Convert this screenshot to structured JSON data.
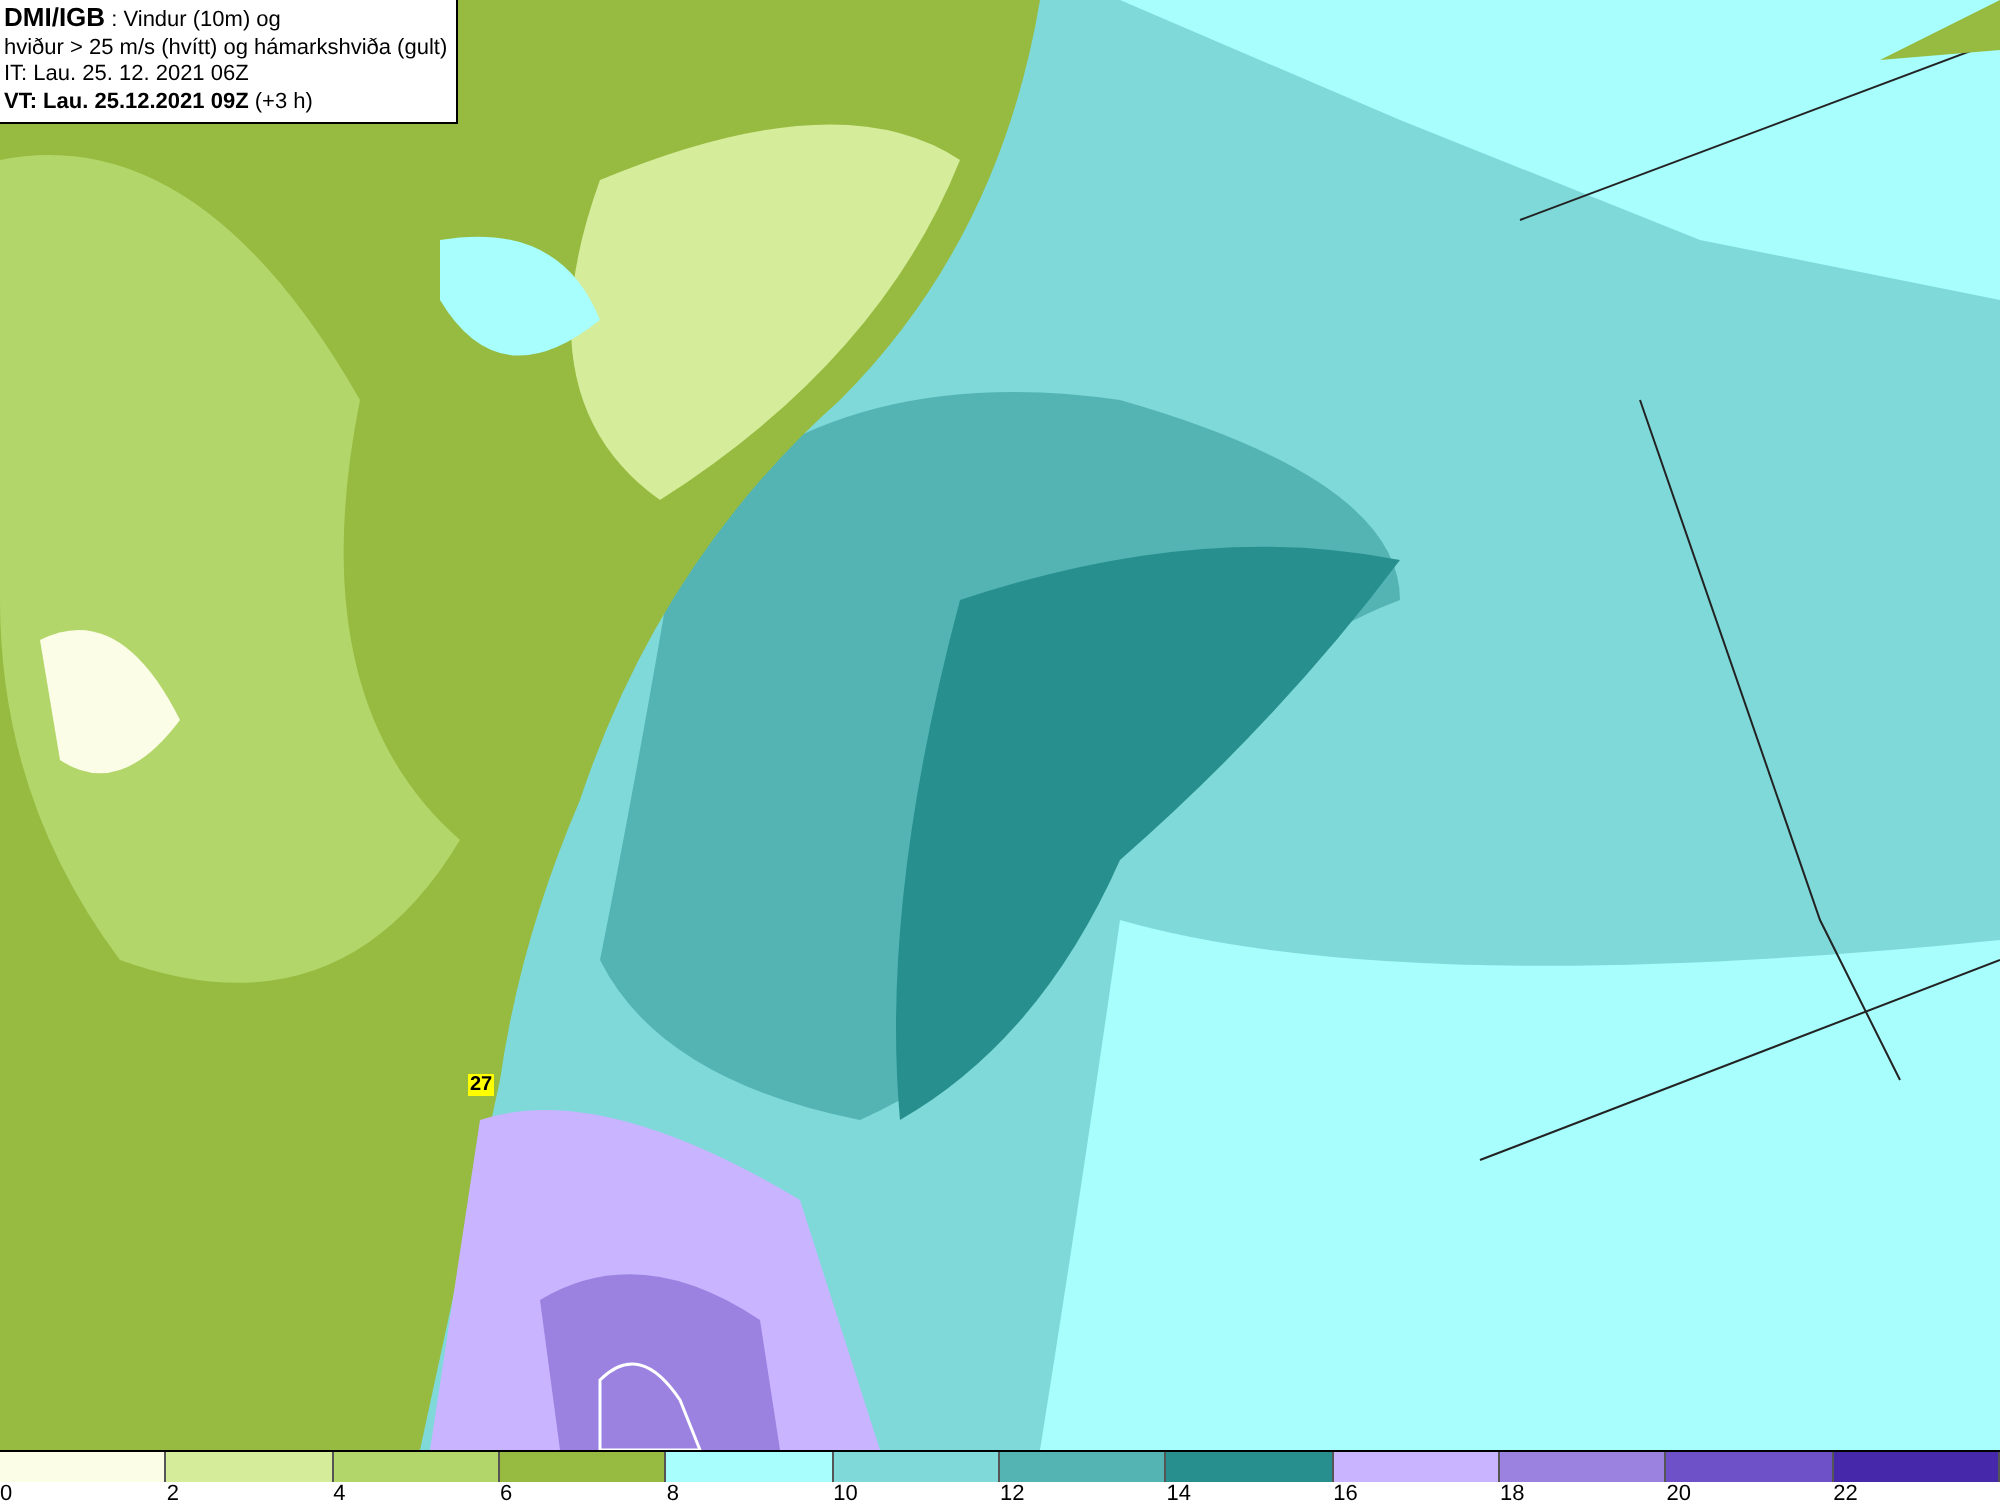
{
  "header": {
    "title": "DMI/IGB",
    "subtitle_1": ": Vindur (10m) og",
    "subtitle_2": "hviður > 25 m/s (hvítt) og hámarkshviða (gult)",
    "issue_time": "IT: Lau. 25. 12. 2021 06Z",
    "valid_time": "VT: Lau. 25.12.2021 09Z",
    "offset": "(+3 h)"
  },
  "map": {
    "gust_marker": "27"
  },
  "legend": [
    {
      "label": "0",
      "color": "#fbfde6"
    },
    {
      "label": "2",
      "color": "#d5ec9a"
    },
    {
      "label": "4",
      "color": "#b2d66a"
    },
    {
      "label": "6",
      "color": "#96bb40"
    },
    {
      "label": "8",
      "color": "#a8fdfd"
    },
    {
      "label": "10",
      "color": "#7fd9d9"
    },
    {
      "label": "12",
      "color": "#54b4b4"
    },
    {
      "label": "14",
      "color": "#27908f"
    },
    {
      "label": "16",
      "color": "#c8b4ff"
    },
    {
      "label": "18",
      "color": "#9b82e0"
    },
    {
      "label": "20",
      "color": "#6e50c8"
    },
    {
      "label": "22",
      "color": "#4628aa"
    }
  ]
}
